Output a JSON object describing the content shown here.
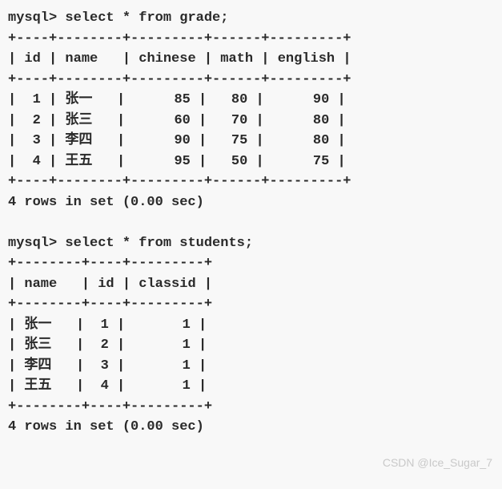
{
  "session": {
    "prompt": "mysql>",
    "query1": "select * from grade;",
    "query2": "select * from students;",
    "result_footer": "4 rows in set (0.00 sec)"
  },
  "grade_table": {
    "columns": [
      "id",
      "name",
      "chinese",
      "math",
      "english"
    ],
    "rows": [
      {
        "id": 1,
        "name": "张一",
        "chinese": 85,
        "math": 80,
        "english": 90
      },
      {
        "id": 2,
        "name": "张三",
        "chinese": 60,
        "math": 70,
        "english": 80
      },
      {
        "id": 3,
        "name": "李四",
        "chinese": 90,
        "math": 75,
        "english": 80
      },
      {
        "id": 4,
        "name": "王五",
        "chinese": 95,
        "math": 50,
        "english": 75
      }
    ]
  },
  "students_table": {
    "columns": [
      "name",
      "id",
      "classid"
    ],
    "rows": [
      {
        "name": "张一",
        "id": 1,
        "classid": 1
      },
      {
        "name": "张三",
        "id": 2,
        "classid": 1
      },
      {
        "name": "李四",
        "id": 3,
        "classid": 1
      },
      {
        "name": "王五",
        "id": 4,
        "classid": 1
      }
    ]
  },
  "watermark": "CSDN @Ice_Sugar_7"
}
